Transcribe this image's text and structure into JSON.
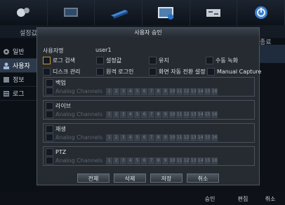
{
  "outer": {
    "left_title": "설정값",
    "right_title": "종료"
  },
  "sidebar": {
    "items": [
      {
        "label": "일반",
        "icon": "gear-icon"
      },
      {
        "label": "사용자",
        "icon": "user-icon"
      },
      {
        "label": "정보",
        "icon": "info-icon"
      },
      {
        "label": "로그",
        "icon": "log-icon"
      }
    ]
  },
  "toolbar": {
    "icons": [
      "camera-settings-icon",
      "monitor-icon",
      "hdd-icon",
      "display-icon",
      "network-icon",
      "power-icon"
    ]
  },
  "bottom": {
    "approve": "승인",
    "edit": "편집",
    "cancel": "취소"
  },
  "dialog": {
    "title": "사용자 승인",
    "user_label": "사용자명",
    "user_value": "user1",
    "permissions": [
      "로그 검색",
      "설정값",
      "유지",
      "수동 녹화",
      "디스크 관리",
      "원격 로그인",
      "화면 자동 전환 설정",
      "Manual Capture"
    ],
    "groups": [
      {
        "name": "백업",
        "channels_label": "Analog Channels"
      },
      {
        "name": "라이브",
        "channels_label": "Analog Channels"
      },
      {
        "name": "재생",
        "channels_label": "Analog Channels"
      },
      {
        "name": "PTZ",
        "channels_label": "Analog Channels"
      }
    ],
    "channels": [
      "1",
      "2",
      "3",
      "4",
      "5",
      "6",
      "7",
      "8",
      "9",
      "10",
      "11",
      "12",
      "13",
      "14",
      "15",
      "16"
    ],
    "buttons": {
      "all": "전체",
      "delete": "삭제",
      "save": "저장",
      "cancel": "취소"
    }
  }
}
